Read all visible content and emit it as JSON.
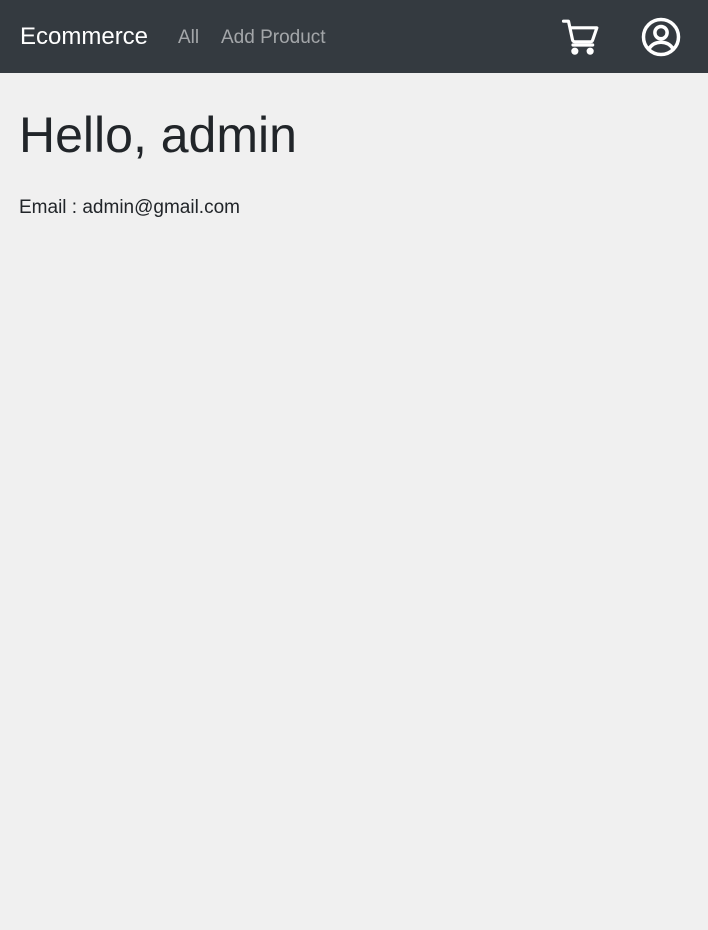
{
  "navbar": {
    "brand": "Ecommerce",
    "links": [
      {
        "label": "All"
      },
      {
        "label": "Add Product"
      }
    ],
    "icons": {
      "cart": "cart-icon",
      "account": "user-circle-icon"
    },
    "colors": {
      "background": "#343a40",
      "brand_text": "#ffffff",
      "link_text": "#9a9da0"
    }
  },
  "profile": {
    "greeting": "Hello, admin",
    "email_label": "Email :",
    "email": "admin@gmail.com"
  },
  "colors": {
    "page_background": "#f0f0f0",
    "text": "#212529"
  }
}
